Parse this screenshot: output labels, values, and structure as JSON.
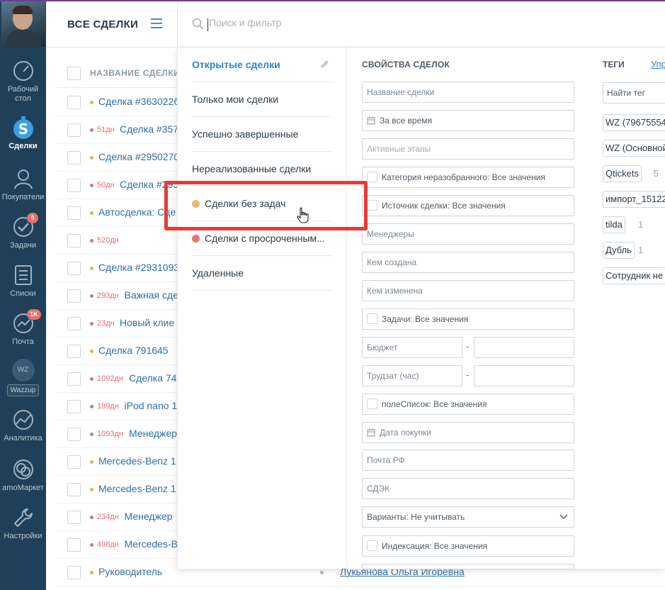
{
  "header": {
    "title": "ВСЕ СДЕЛКИ",
    "search_placeholder": "Поиск и фильтр"
  },
  "sidebar": {
    "items": [
      {
        "label": "Рабочий стол",
        "icon": "speedometer-icon"
      },
      {
        "label": "Сделки",
        "icon": "deals-dollar-icon",
        "active": true
      },
      {
        "label": "Покупатели",
        "icon": "customers-icon"
      },
      {
        "label": "Задачи",
        "icon": "tasks-check-icon",
        "badge": "8"
      },
      {
        "label": "Списки",
        "icon": "lists-icon"
      },
      {
        "label": "Почта",
        "icon": "mail-icon",
        "badge": "1K"
      },
      {
        "label": "Wazzup",
        "icon": "wazzup-icon",
        "circle": "WZ"
      },
      {
        "label": "Аналитика",
        "icon": "analytics-icon"
      },
      {
        "label": "amoМаркет",
        "icon": "market-icon"
      },
      {
        "label": "Настройки",
        "icon": "settings-wrench-icon"
      }
    ]
  },
  "list": {
    "header_label": "НАЗВАНИЕ СДЕЛКИ",
    "rows": [
      {
        "days": "",
        "name": "Сделка #363022б",
        "dot": "#e8b04f"
      },
      {
        "days": "51дн",
        "name": "Сделка #357",
        "dot": "#e06e7a"
      },
      {
        "days": "",
        "name": "Сделка #2950270",
        "dot": "#e8b04f"
      },
      {
        "days": "50дн",
        "name": "Сделка #295",
        "dot": "#e06e7a"
      },
      {
        "days": "",
        "name": "Автосделка: Сде",
        "dot": "#e8b04f"
      },
      {
        "days": "520дн",
        "name": "",
        "dot": "#e06e7a"
      },
      {
        "days": "",
        "name": "Сделка #2931093",
        "dot": "#e8b04f"
      },
      {
        "days": "293дн",
        "name": "Важная сде",
        "dot": "#e06e7a"
      },
      {
        "days": "23дн",
        "name": "Новый клие",
        "dot": "#e06e7a"
      },
      {
        "days": "",
        "name": "Сделка 791645",
        "dot": "#e8b04f"
      },
      {
        "days": "1092дн",
        "name": "Сделка 74",
        "dot": "#e06e7a"
      },
      {
        "days": "199дн",
        "name": "iPod nano 1",
        "dot": "#e06e7a"
      },
      {
        "days": "1093дн",
        "name": "Менеджер",
        "dot": "#e06e7a"
      },
      {
        "days": "",
        "name": "Mercedes-Benz 1",
        "dot": "#e8b04f"
      },
      {
        "days": "",
        "name": "Mercedes-Benz 1",
        "dot": "#e8b04f"
      },
      {
        "days": "234дн",
        "name": "Менеджер",
        "dot": "#e06e7a"
      },
      {
        "days": "498дн",
        "name": "Mercedes-B",
        "dot": "#e06e7a"
      },
      {
        "days": "",
        "name": "Руководитель",
        "dot": "#e8b04f",
        "extra": "Лукьянова Ольга Игоревна"
      }
    ]
  },
  "presets": [
    {
      "label": "Открытые сделки",
      "active": true
    },
    {
      "label": "Только мои сделки"
    },
    {
      "label": "Успешно завершенные"
    },
    {
      "label": "Нереализованные сделки"
    },
    {
      "label": "Сделки без задач",
      "dot": "#e9b872"
    },
    {
      "label": "Сделки с просроченным...",
      "dot": "#e8727a"
    },
    {
      "label": "Удаленные"
    }
  ],
  "properties": {
    "title": "СВОЙСТВА СДЕЛОК",
    "fields": {
      "name": "Название сделки",
      "period": "За все время",
      "stages": "Активные этапы",
      "category": "Категория неразобранного: Все значения",
      "source": "Источник сделки: Все значения",
      "managers": "Менеджеры",
      "created_by": "Кем создана",
      "changed_by": "Кем изменена",
      "tasks": "Задачи: Все значения",
      "budget": "Бюджет",
      "labor": "Трудзат (час)",
      "list_field": "полеСписок: Все значения",
      "purchase_date": "Дата покупки",
      "russian_post": "Почта РФ",
      "cdek": "СДЭК",
      "variants": "Варианты: Не учитывать",
      "indexation": "Индексация: Все значения"
    }
  },
  "tags": {
    "title": "ТЕГИ",
    "manage": "Упр",
    "search": "Найти тег",
    "items": [
      {
        "label": "WZ (79675554",
        "count": ""
      },
      {
        "label": "WZ (Основной",
        "count": ""
      },
      {
        "label": "Qtickets",
        "count": "5"
      },
      {
        "label": "импорт_15122",
        "count": ""
      },
      {
        "label": "tilda",
        "count": "1"
      },
      {
        "label": "Дубль",
        "count": "1"
      },
      {
        "label": "Сотрудник не",
        "count": ""
      }
    ]
  },
  "colors": {
    "accent": "#2e85c7",
    "sidebar": "#1f4058",
    "highlight": "#ea3a35"
  }
}
